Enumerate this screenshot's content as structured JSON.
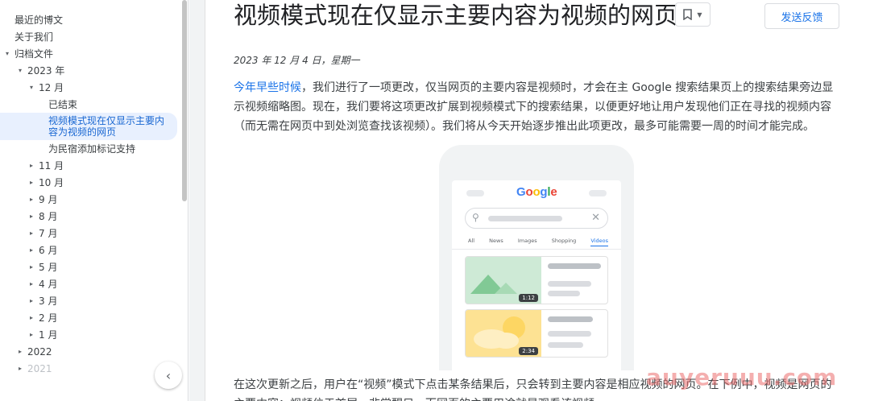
{
  "sidebar": {
    "items": [
      {
        "label": "最近的博文",
        "level": 0,
        "arrow": ""
      },
      {
        "label": "关于我们",
        "level": 0,
        "arrow": ""
      },
      {
        "label": "归档文件",
        "level": 0,
        "arrow": "▾"
      },
      {
        "label": "2023 年",
        "level": 1,
        "arrow": "▾"
      },
      {
        "label": "12 月",
        "level": 2,
        "arrow": "▾"
      },
      {
        "label": "已结束",
        "level": 3,
        "arrow": ""
      },
      {
        "label": "视频模式现在仅显示主要内容为视频的网页",
        "level": 3,
        "arrow": "",
        "active": true
      },
      {
        "label": "为民宿添加标记支持",
        "level": 3,
        "arrow": ""
      },
      {
        "label": "11 月",
        "level": 2,
        "arrow": "▸"
      },
      {
        "label": "10 月",
        "level": 2,
        "arrow": "▸"
      },
      {
        "label": "9 月",
        "level": 2,
        "arrow": "▸"
      },
      {
        "label": "8 月",
        "level": 2,
        "arrow": "▸"
      },
      {
        "label": "7 月",
        "level": 2,
        "arrow": "▸"
      },
      {
        "label": "6 月",
        "level": 2,
        "arrow": "▸"
      },
      {
        "label": "5 月",
        "level": 2,
        "arrow": "▸"
      },
      {
        "label": "4 月",
        "level": 2,
        "arrow": "▸"
      },
      {
        "label": "3 月",
        "level": 2,
        "arrow": "▸"
      },
      {
        "label": "2 月",
        "level": 2,
        "arrow": "▸"
      },
      {
        "label": "1 月",
        "level": 2,
        "arrow": "▸"
      },
      {
        "label": "2022",
        "level": 1,
        "arrow": "▸"
      },
      {
        "label": "2021",
        "level": 1,
        "arrow": "▸",
        "faded": true
      }
    ],
    "collapse_icon": "chevron-left-icon"
  },
  "article": {
    "title": "视频模式现在仅显示主要内容为视频的网页",
    "bookmark_icon": "bookmark-icon",
    "feedback_label": "发送反馈",
    "date": "2023 年 12 月 4 日，星期一",
    "para1_link": "今年早些时候",
    "para1_text": "，我们进行了一项更改，仅当网页的主要内容是视频时，才会在主 Google 搜索结果页上的搜索结果旁边显示视频缩略图。现在，我们要将这项更改扩展到视频模式下的搜索结果，以便更好地让用户发现他们正在寻找的视频内容（而无需在网页中到处浏览查找该视频）。我们将从今天开始逐步推出此项更改，最多可能需要一周的时间才能完成。",
    "para2_text": "在这次更新之后，用户在“视频”模式下点击某条结果后，只会转到主要内容是相应视频的网页。在下例中，视频是网页的主要内容：视频位于首屏，非常醒目，而网页的主要用途就是观看该视频。"
  },
  "illustration": {
    "logo": "Google",
    "tabs": [
      "All",
      "News",
      "Images",
      "Shopping",
      "Videos"
    ],
    "active_tab": "Videos",
    "durations": [
      "1:12",
      "2:34"
    ]
  },
  "watermark": "auyeruuu.com",
  "colors": {
    "accent": "#1a73e8",
    "active_bg": "#e8f0fe",
    "green_thumb": "#ceead6",
    "yellow_thumb": "#fde293"
  }
}
